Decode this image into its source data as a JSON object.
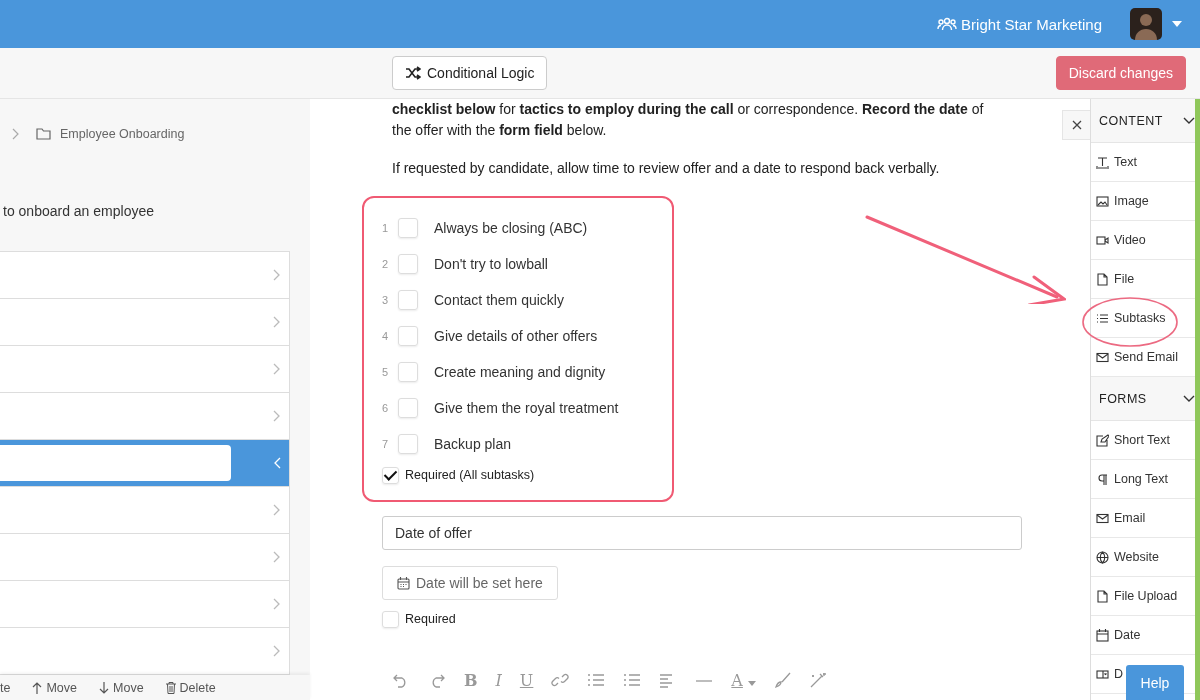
{
  "header": {
    "account": "Bright Star Marketing"
  },
  "toolbar": {
    "logic_button": "Conditional Logic",
    "discard_button": "Discard changes"
  },
  "left_panel": {
    "breadcrumb": "Employee Onboarding",
    "title": "to onboard an employee",
    "rows": [
      {
        "selected": false
      },
      {
        "selected": false
      },
      {
        "selected": false
      },
      {
        "selected": false
      },
      {
        "selected": true
      },
      {
        "selected": false
      },
      {
        "selected": false
      },
      {
        "selected": false
      },
      {
        "selected": false
      }
    ],
    "actions": [
      {
        "kind": "cut",
        "label": "te"
      },
      {
        "kind": "up",
        "label": "Move"
      },
      {
        "kind": "down",
        "label": "Move"
      },
      {
        "kind": "delete",
        "label": "Delete"
      }
    ]
  },
  "content": {
    "paragraphs": [
      "**checklist below** for **tactics to employ during the call** or correspondence. **Record the date** of the offer with the **form field** below.",
      "If requested by candidate, allow time to review offer and a date to respond back verbally."
    ],
    "subtasks": [
      {
        "number": "1",
        "label": "Always be closing (ABC)",
        "checked": false
      },
      {
        "number": "2",
        "label": "Don't try to lowball",
        "checked": false
      },
      {
        "number": "3",
        "label": "Contact them quickly",
        "checked": false
      },
      {
        "number": "4",
        "label": "Give details of other offers",
        "checked": false
      },
      {
        "number": "5",
        "label": "Create meaning and dignity",
        "checked": false
      },
      {
        "number": "6",
        "label": "Give them the royal treatment",
        "checked": false
      },
      {
        "number": "7",
        "label": "Backup plan",
        "checked": false
      }
    ],
    "subtasks_required": {
      "label": "Required (All subtasks)",
      "checked": true
    },
    "field_label": "Date of offer",
    "date_placeholder": "Date will be set here",
    "date_required": {
      "label": "Required",
      "checked": false
    },
    "editor_tools": [
      {
        "kind": "undo"
      },
      {
        "kind": "redo"
      },
      {
        "kind": "text",
        "label": "B"
      },
      {
        "kind": "text",
        "label": "I"
      },
      {
        "kind": "text",
        "label": "U"
      },
      {
        "kind": "link"
      },
      {
        "kind": "bullets"
      },
      {
        "kind": "numbers"
      },
      {
        "kind": "align"
      },
      {
        "kind": "rule"
      },
      {
        "kind": "color",
        "label": "A"
      },
      {
        "kind": "brush"
      },
      {
        "kind": "magic"
      }
    ]
  },
  "sidebar": {
    "sections": [
      {
        "title": "CONTENT",
        "items": [
          {
            "kind": "text",
            "label": "Text"
          },
          {
            "kind": "image",
            "label": "Image"
          },
          {
            "kind": "video",
            "label": "Video"
          },
          {
            "kind": "file",
            "label": "File"
          },
          {
            "kind": "list",
            "label": "Subtasks"
          },
          {
            "kind": "mail",
            "label": "Send Email"
          }
        ]
      },
      {
        "title": "FORMS",
        "items": [
          {
            "kind": "edit",
            "label": "Short Text"
          },
          {
            "kind": "para",
            "label": "Long Text"
          },
          {
            "kind": "mail",
            "label": "Email"
          },
          {
            "kind": "globe",
            "label": "Website"
          },
          {
            "kind": "file",
            "label": "File Upload"
          },
          {
            "kind": "date",
            "label": "Date"
          },
          {
            "kind": "dropdown",
            "label": "D"
          }
        ]
      }
    ],
    "help_button": "Help"
  }
}
